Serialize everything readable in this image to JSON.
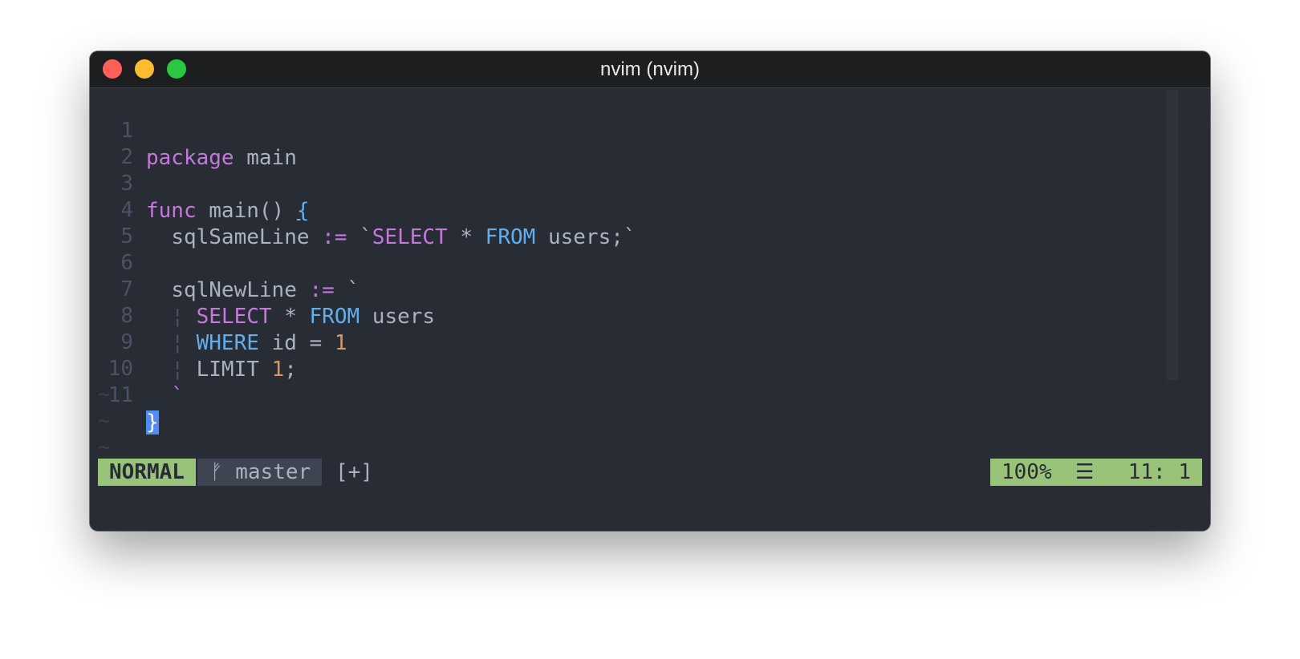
{
  "window": {
    "title": "nvim (nvim)"
  },
  "colors": {
    "keyword": "#c678dd",
    "sql_keyword": "#61afef",
    "number": "#d19a66",
    "text": "#abb2bf",
    "mode_bg": "#98c379",
    "cursor_bg": "#528bff"
  },
  "editor": {
    "line_numbers": [
      "1",
      "2",
      "3",
      "4",
      "5",
      "6",
      "7",
      "8",
      "9",
      "10",
      "11"
    ],
    "code": {
      "l1_kw": "package",
      "l1_rest": " main",
      "l3_kw": "func",
      "l3_rest": " main() ",
      "l3_brace": "{",
      "l4_a": "sqlSameLine ",
      "l4_op": ":=",
      "l4_b": " `",
      "l4_select": "SELECT",
      "l4_c": " * ",
      "l4_from": "FROM",
      "l4_d": " users;`",
      "l6_a": "sqlNewLine ",
      "l6_op": ":=",
      "l6_b": " `",
      "guide": "¦",
      "l7_select": "SELECT",
      "l7_a": " * ",
      "l7_from": "FROM",
      "l7_b": " users",
      "l8_where": "WHERE",
      "l8_a": " id = ",
      "l8_num": "1",
      "l9_a": "LIMIT ",
      "l9_num": "1",
      "l9_b": ";",
      "l10": "`",
      "l11_cursor": "}"
    },
    "tilde": "~"
  },
  "statusline": {
    "mode": "NORMAL",
    "branch": "ᚠ master",
    "modified": "[+]",
    "percent": "100%",
    "lines_icon": "☰",
    "position": "11:  1"
  }
}
